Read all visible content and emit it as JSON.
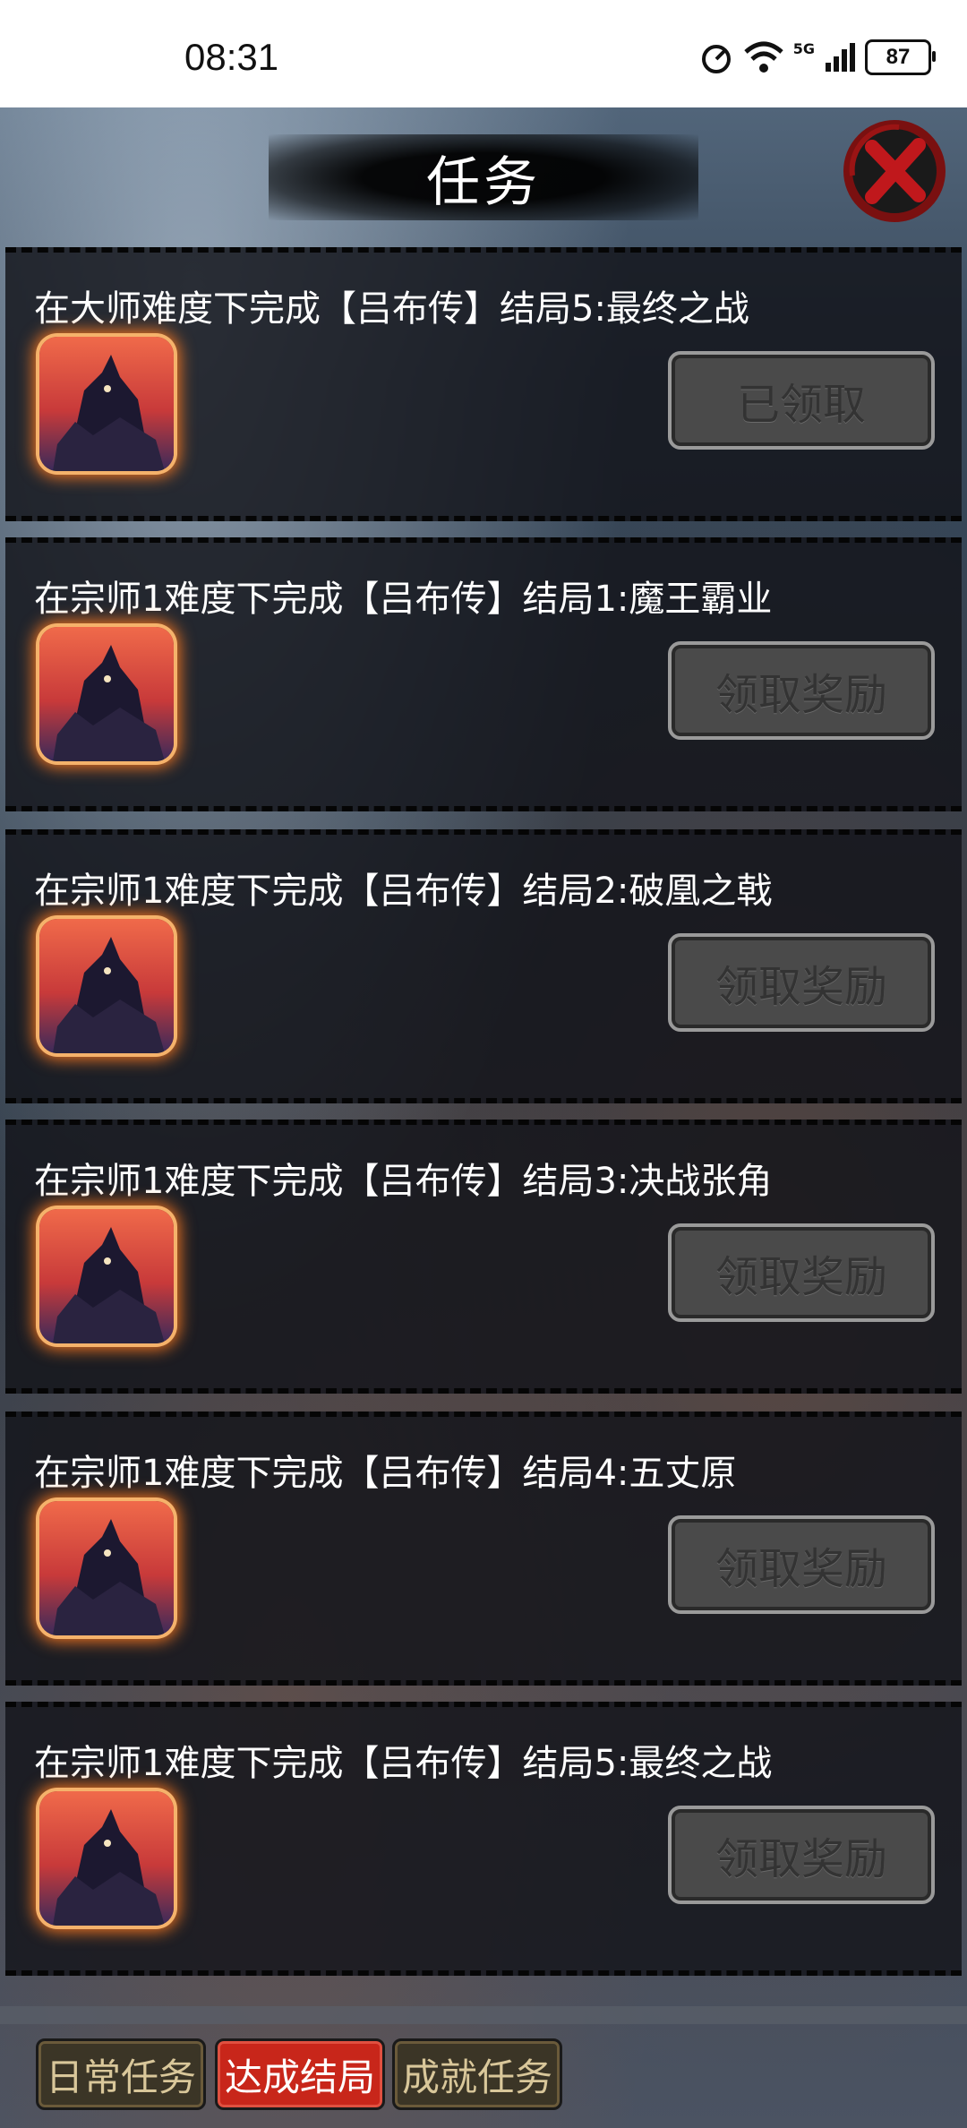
{
  "status_bar": {
    "time": "08:31",
    "network": "5G",
    "battery": "87"
  },
  "header": {
    "title": "任务"
  },
  "tasks": [
    {
      "title": "在大师难度下完成【吕布传】结局5:最终之战",
      "button_label": "已领取",
      "claimed": true
    },
    {
      "title": "在宗师1难度下完成【吕布传】结局1:魔王霸业",
      "button_label": "领取奖励",
      "claimed": false
    },
    {
      "title": "在宗师1难度下完成【吕布传】结局2:破凰之戟",
      "button_label": "领取奖励",
      "claimed": false
    },
    {
      "title": "在宗师1难度下完成【吕布传】结局3:决战张角",
      "button_label": "领取奖励",
      "claimed": false
    },
    {
      "title": "在宗师1难度下完成【吕布传】结局4:五丈原",
      "button_label": "领取奖励",
      "claimed": false
    },
    {
      "title": "在宗师1难度下完成【吕布传】结局5:最终之战",
      "button_label": "领取奖励",
      "claimed": false
    }
  ],
  "tabs": [
    {
      "label": "日常任务",
      "active": false
    },
    {
      "label": "达成结局",
      "active": true
    },
    {
      "label": "成就任务",
      "active": false
    }
  ],
  "colors": {
    "active_tab": "#c8261a",
    "icon_glow": "#ff7a20",
    "button_disabled": "#4a4a4a"
  }
}
